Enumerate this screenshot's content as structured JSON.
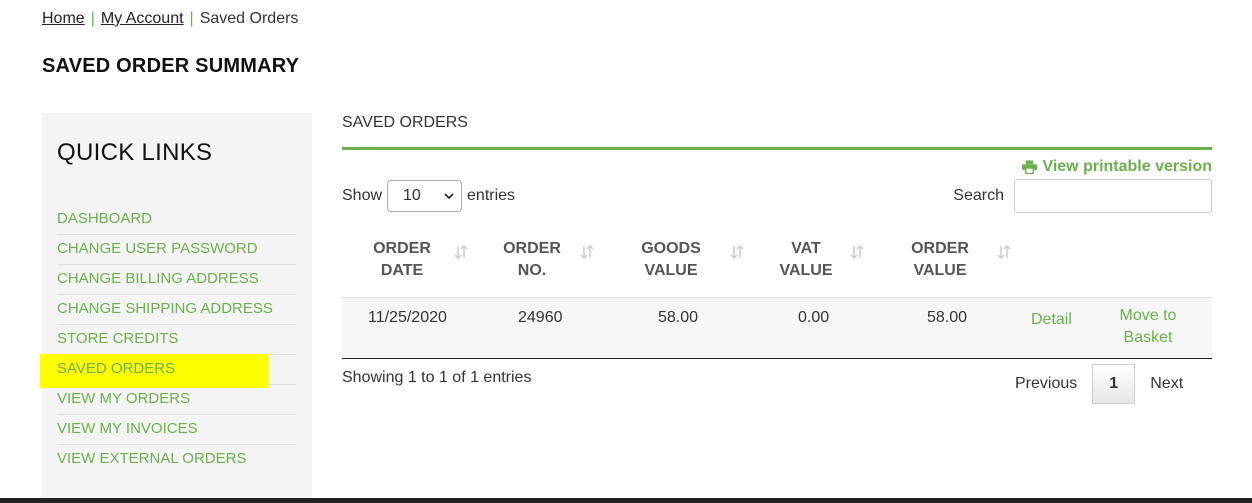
{
  "breadcrumb": {
    "home": "Home",
    "account": "My Account",
    "separator": "|",
    "current": "Saved Orders"
  },
  "page_title": "SAVED ORDER SUMMARY",
  "sidebar": {
    "title": "QUICK LINKS",
    "items": [
      {
        "label": "DASHBOARD"
      },
      {
        "label": "CHANGE USER PASSWORD"
      },
      {
        "label": "CHANGE BILLING ADDRESS"
      },
      {
        "label": "CHANGE SHIPPING ADDRESS"
      },
      {
        "label": "STORE CREDITS"
      },
      {
        "label": "SAVED ORDERS",
        "active": true
      },
      {
        "label": "VIEW MY ORDERS"
      },
      {
        "label": "VIEW MY INVOICES"
      },
      {
        "label": "VIEW EXTERNAL ORDERS"
      }
    ]
  },
  "main": {
    "section_title": "SAVED ORDERS",
    "print_link": "View printable version",
    "show_label": "Show",
    "entries_value": "10",
    "entries_label": "entries",
    "search_label": "Search",
    "search_value": "",
    "columns": [
      {
        "line1": "ORDER",
        "line2": "DATE"
      },
      {
        "line1": "ORDER",
        "line2": "NO."
      },
      {
        "line1": "GOODS",
        "line2": "VALUE"
      },
      {
        "line1": "VAT",
        "line2": "VALUE"
      },
      {
        "line1": "ORDER",
        "line2": "VALUE"
      }
    ],
    "rows": [
      {
        "order_date": "11/25/2020",
        "order_no": "24960",
        "goods_value": "58.00",
        "vat_value": "0.00",
        "order_value": "58.00",
        "detail": "Detail",
        "move_line1": "Move to",
        "move_line2": "Basket"
      }
    ],
    "showing_text": "Showing 1 to 1 of 1 entries",
    "pagination": {
      "previous": "Previous",
      "page": "1",
      "next": "Next"
    }
  },
  "colors": {
    "accent_green": "#6ab04c",
    "highlight": "#ffff00",
    "sidebar_bg": "#f4f4f4"
  },
  "icons": {
    "print": "printer-icon",
    "sort": "sort-arrows-icon",
    "select": "chevron-down-icon"
  }
}
